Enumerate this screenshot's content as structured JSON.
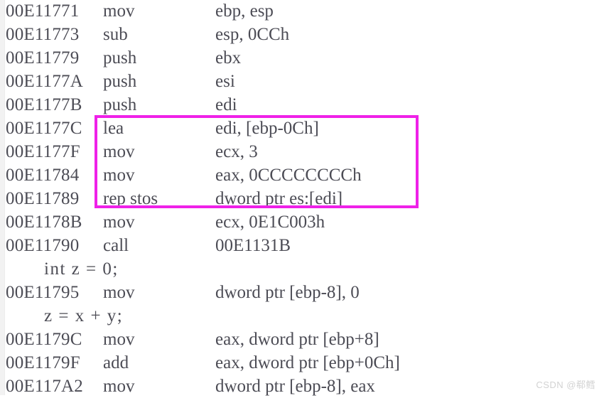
{
  "view": {
    "name": "disassembly-view",
    "background_color": "#ffffff",
    "text_color": "#4c4c55",
    "selection_color": "#ef21e8"
  },
  "lines": [
    {
      "type": "asm",
      "address": "00E11771",
      "mnemonic": "mov",
      "operands": "ebp, esp"
    },
    {
      "type": "asm",
      "address": "00E11773",
      "mnemonic": "sub",
      "operands": "esp, 0CCh"
    },
    {
      "type": "asm",
      "address": "00E11779",
      "mnemonic": "push",
      "operands": "ebx"
    },
    {
      "type": "asm",
      "address": "00E1177A",
      "mnemonic": "push",
      "operands": "esi"
    },
    {
      "type": "asm",
      "address": "00E1177B",
      "mnemonic": "push",
      "operands": "edi"
    },
    {
      "type": "asm",
      "address": "00E1177C",
      "mnemonic": "lea",
      "operands": "edi, [ebp-0Ch]"
    },
    {
      "type": "asm",
      "address": "00E1177F",
      "mnemonic": "mov",
      "operands": "ecx, 3"
    },
    {
      "type": "asm",
      "address": "00E11784",
      "mnemonic": "mov",
      "operands": "eax, 0CCCCCCCCh"
    },
    {
      "type": "asm",
      "address": "00E11789",
      "mnemonic": "rep stos",
      "operands": "dword ptr es:[edi]"
    },
    {
      "type": "asm",
      "address": "00E1178B",
      "mnemonic": "mov",
      "operands": "ecx, 0E1C003h"
    },
    {
      "type": "asm",
      "address": "00E11790",
      "mnemonic": "call",
      "operands": "00E1131B"
    },
    {
      "type": "source",
      "source_text": "int z = 0;"
    },
    {
      "type": "asm",
      "address": "00E11795",
      "mnemonic": "mov",
      "operands": "dword ptr [ebp-8], 0"
    },
    {
      "type": "source",
      "source_text": "z = x + y;"
    },
    {
      "type": "asm",
      "address": "00E1179C",
      "mnemonic": "mov",
      "operands": "eax, dword ptr [ebp+8]"
    },
    {
      "type": "asm",
      "address": "00E1179F",
      "mnemonic": "add",
      "operands": "eax, dword ptr [ebp+0Ch]"
    },
    {
      "type": "asm",
      "address": "00E117A2",
      "mnemonic": "mov",
      "operands": "dword ptr [ebp-8], eax"
    }
  ],
  "selection": {
    "label": "highlighted-instruction-block",
    "first_address": "00E1177C",
    "last_address": "00E11789",
    "color": "#ef21e8"
  },
  "watermark": {
    "text": "CSDN @郗鳕"
  }
}
